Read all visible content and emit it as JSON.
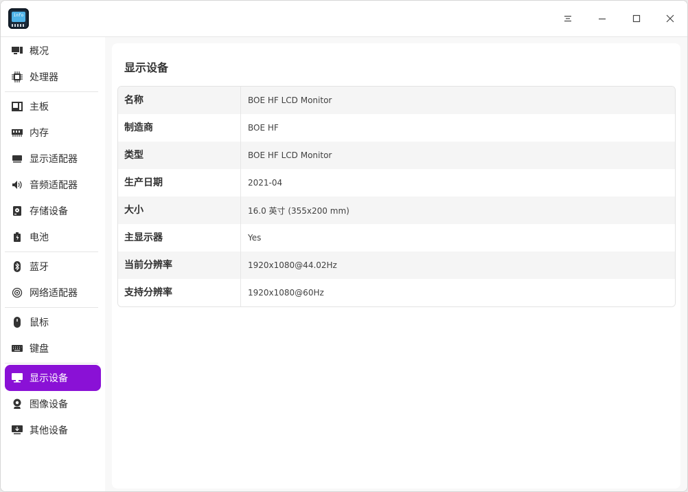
{
  "app": {
    "icon_text": "info",
    "accent": "#8a11d6"
  },
  "titlebar": {
    "menu_icon": "hamburger-menu-icon",
    "minimize_icon": "minimize-icon",
    "maximize_icon": "maximize-icon",
    "close_icon": "close-icon"
  },
  "sidebar": {
    "groups": [
      [
        {
          "label": "概况",
          "icon": "overview-icon"
        },
        {
          "label": "处理器",
          "icon": "cpu-icon"
        }
      ],
      [
        {
          "label": "主板",
          "icon": "motherboard-icon"
        },
        {
          "label": "内存",
          "icon": "memory-icon"
        },
        {
          "label": "显示适配器",
          "icon": "display-adapter-icon"
        },
        {
          "label": "音频适配器",
          "icon": "speaker-icon"
        },
        {
          "label": "存储设备",
          "icon": "storage-icon"
        },
        {
          "label": "电池",
          "icon": "battery-icon"
        }
      ],
      [
        {
          "label": "蓝牙",
          "icon": "bluetooth-icon"
        },
        {
          "label": "网络适配器",
          "icon": "network-icon"
        }
      ],
      [
        {
          "label": "鼠标",
          "icon": "mouse-icon"
        },
        {
          "label": "键盘",
          "icon": "keyboard-icon"
        }
      ],
      [
        {
          "label": "显示设备",
          "icon": "monitor-icon",
          "active": true
        },
        {
          "label": "图像设备",
          "icon": "camera-icon"
        },
        {
          "label": "其他设备",
          "icon": "other-device-icon"
        }
      ]
    ]
  },
  "main": {
    "title": "显示设备",
    "rows": [
      {
        "key": "名称",
        "value": "BOE HF LCD Monitor"
      },
      {
        "key": "制造商",
        "value": "BOE HF"
      },
      {
        "key": "类型",
        "value": "BOE HF LCD Monitor"
      },
      {
        "key": "生产日期",
        "value": "2021-04"
      },
      {
        "key": "大小",
        "value": "16.0 英寸 (355x200 mm)"
      },
      {
        "key": "主显示器",
        "value": "Yes"
      },
      {
        "key": "当前分辨率",
        "value": "1920x1080@44.02Hz"
      },
      {
        "key": "支持分辨率",
        "value": "1920x1080@60Hz"
      }
    ]
  }
}
